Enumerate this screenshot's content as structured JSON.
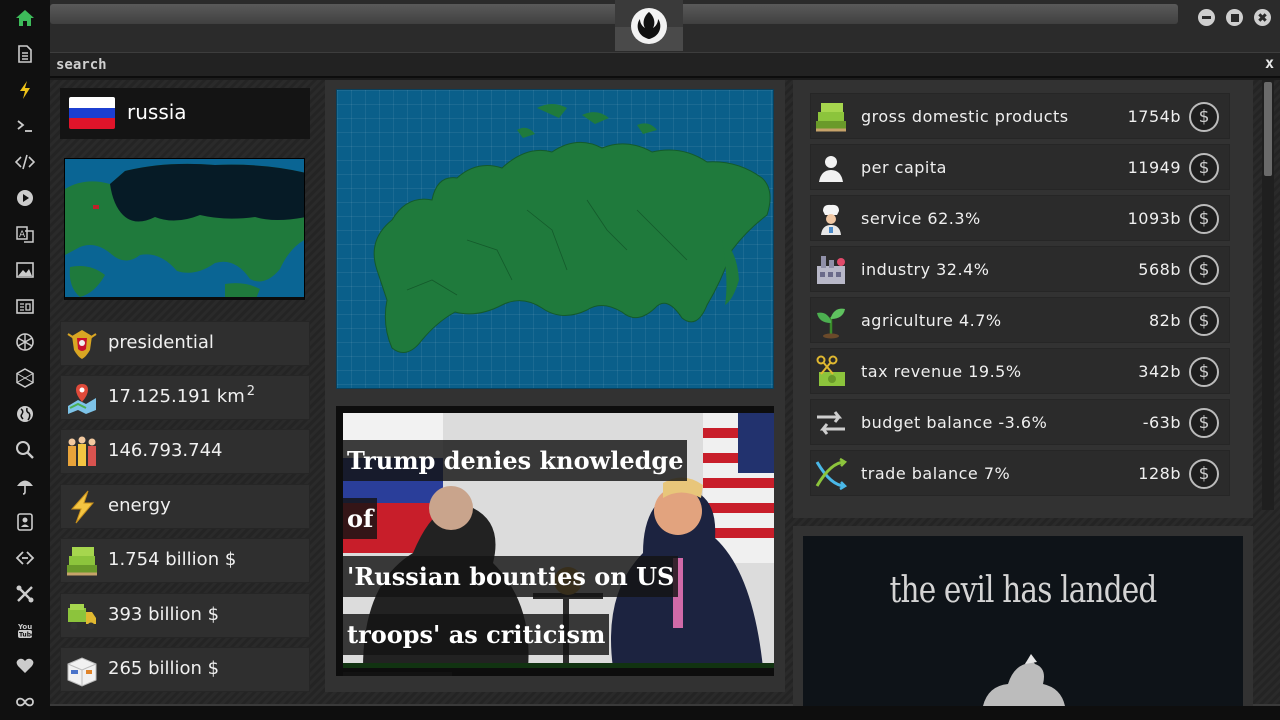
{
  "sidebar": {
    "items": [
      {
        "icon": "home-icon"
      },
      {
        "icon": "document-icon"
      },
      {
        "icon": "lightning-icon"
      },
      {
        "icon": "terminal-icon"
      },
      {
        "icon": "code-icon"
      },
      {
        "icon": "play-icon"
      },
      {
        "icon": "translate-icon"
      },
      {
        "icon": "image-icon"
      },
      {
        "icon": "newspaper-icon"
      },
      {
        "icon": "aperture-icon"
      },
      {
        "icon": "hexagon-icon"
      },
      {
        "icon": "globe-icon"
      },
      {
        "icon": "search-icon"
      },
      {
        "icon": "umbrella-icon"
      },
      {
        "icon": "contact-icon"
      },
      {
        "icon": "link-icon"
      },
      {
        "icon": "tools-icon"
      },
      {
        "icon": "youtube-icon"
      },
      {
        "icon": "heart-icon"
      },
      {
        "icon": "infinity-icon"
      }
    ],
    "active_color": "#3dbb5a"
  },
  "search": {
    "placeholder": "search",
    "close_label": "x"
  },
  "country": {
    "name": "russia",
    "flag_colors": [
      "#ffffff",
      "#1c3fd1",
      "#e0142a"
    ],
    "stats": [
      {
        "icon": "coat-of-arms-icon",
        "label": "presidential"
      },
      {
        "icon": "area-map-icon",
        "label": "17.125.191 km",
        "sup": "2"
      },
      {
        "icon": "population-icon",
        "label": "146.793.744"
      },
      {
        "icon": "energy-icon",
        "label": "energy"
      },
      {
        "icon": "money-stack-icon",
        "label": "1.754 billion $"
      },
      {
        "icon": "money-truck-icon",
        "label": "393 billion $"
      },
      {
        "icon": "parcel-icon",
        "label": "265 billion $"
      }
    ]
  },
  "news": {
    "headline_line1": "Trump denies knowledge of",
    "headline_line2": "'Russian bounties on US",
    "headline_line3": "troops' as criticism mounts"
  },
  "economy": {
    "rows": [
      {
        "icon": "money-stack-icon",
        "label": "gross domestic products",
        "value": "1754b"
      },
      {
        "icon": "person-icon",
        "label": "per capita",
        "value": "11949"
      },
      {
        "icon": "chef-icon",
        "label": "service 62.3%",
        "value": "1093b"
      },
      {
        "icon": "factory-icon",
        "label": "industry 32.4%",
        "value": "568b"
      },
      {
        "icon": "plant-icon",
        "label": "agriculture 4.7%",
        "value": "82b"
      },
      {
        "icon": "scissors-money-icon",
        "label": "tax revenue 19.5%",
        "value": "342b"
      },
      {
        "icon": "balance-arrows-icon",
        "label": "budget balance -3.6%",
        "value": "-63b"
      },
      {
        "icon": "trade-cross-icon",
        "label": "trade balance 7%",
        "value": "128b"
      }
    ],
    "currency_symbol": "$"
  },
  "promo": {
    "text": "the evil has landed"
  }
}
